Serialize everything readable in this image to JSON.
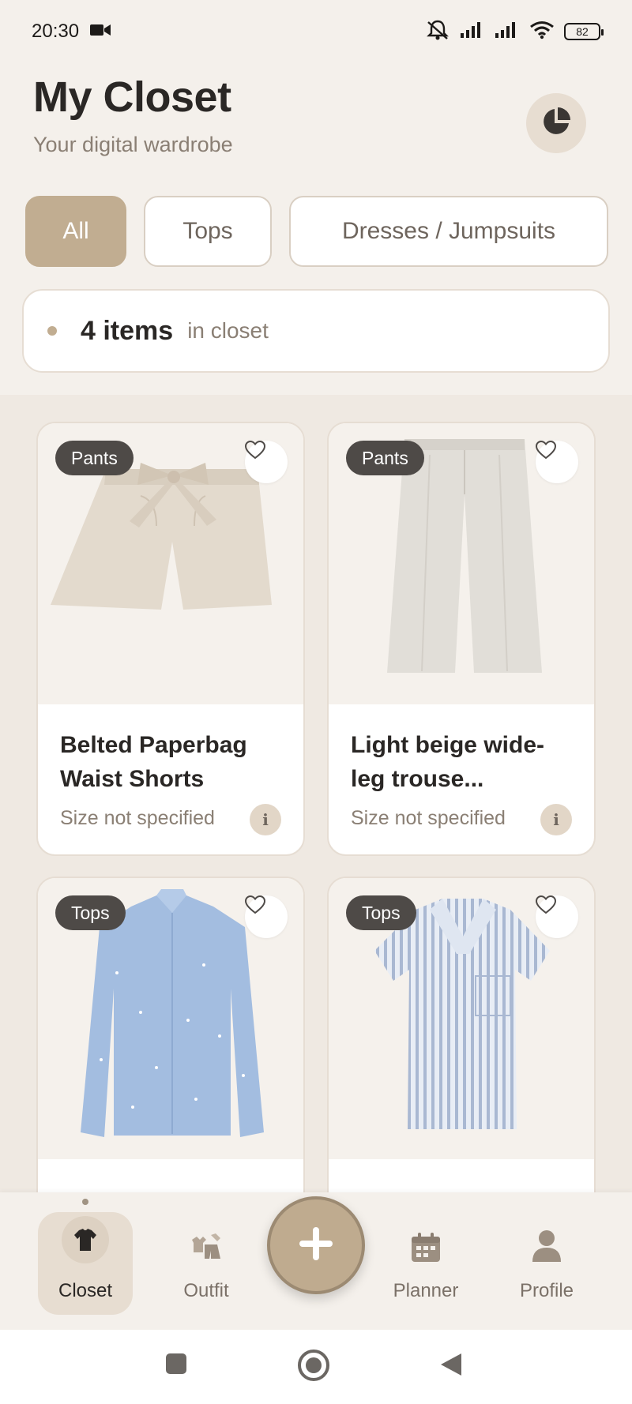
{
  "status_bar": {
    "time": "20:30",
    "battery": "82",
    "icons": [
      "video-camera-icon",
      "mute-icon",
      "signal-icon",
      "signal-icon",
      "wifi-icon",
      "battery-icon"
    ]
  },
  "header": {
    "title": "My Closet",
    "subtitle": "Your digital wardrobe",
    "stats_icon": "pie-chart-icon"
  },
  "filters": [
    {
      "label": "All",
      "active": true
    },
    {
      "label": "Tops",
      "active": false
    },
    {
      "label": "Dresses / Jumpsuits",
      "active": false
    }
  ],
  "count": {
    "value": "4 items",
    "suffix": "in closet"
  },
  "items": [
    {
      "category": "Pants",
      "title": "Belted Paperbag Waist Shorts",
      "size": "Size not specified"
    },
    {
      "category": "Pants",
      "title": "Light beige wide-leg trouse...",
      "size": "Size not specified"
    },
    {
      "category": "Tops",
      "title": "",
      "size": ""
    },
    {
      "category": "Tops",
      "title": "",
      "size": ""
    }
  ],
  "nav": {
    "closet": "Closet",
    "outfit": "Outfit",
    "planner": "Planner",
    "profile": "Profile"
  },
  "colors": {
    "accent": "#c1ad91",
    "background": "#f4f0eb",
    "tag": "#4e4a47"
  }
}
